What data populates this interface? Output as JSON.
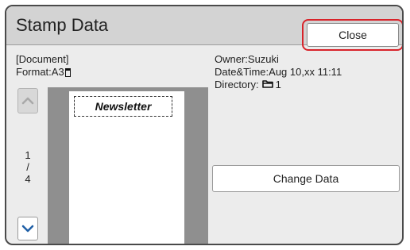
{
  "dialog": {
    "title": "Stamp Data",
    "close_label": "Close"
  },
  "document": {
    "heading": "[Document]",
    "format_label": "Format:",
    "format_value": "A3",
    "format_icon": "portrait-page-icon"
  },
  "details": {
    "owner": "Owner:Suzuki",
    "datetime": "Date&Time:Aug 10,xx 11:11",
    "directory_label": "Directory:",
    "directory_icon": "folder-icon",
    "directory_value": "1"
  },
  "pager": {
    "current": "1",
    "separator": "/",
    "total": "4"
  },
  "preview": {
    "stamp_text": "Newsletter"
  },
  "actions": {
    "change_data_label": "Change Data"
  },
  "colors": {
    "highlight_ring": "#d8232a",
    "nav_arrow": "#1f5fa6"
  }
}
